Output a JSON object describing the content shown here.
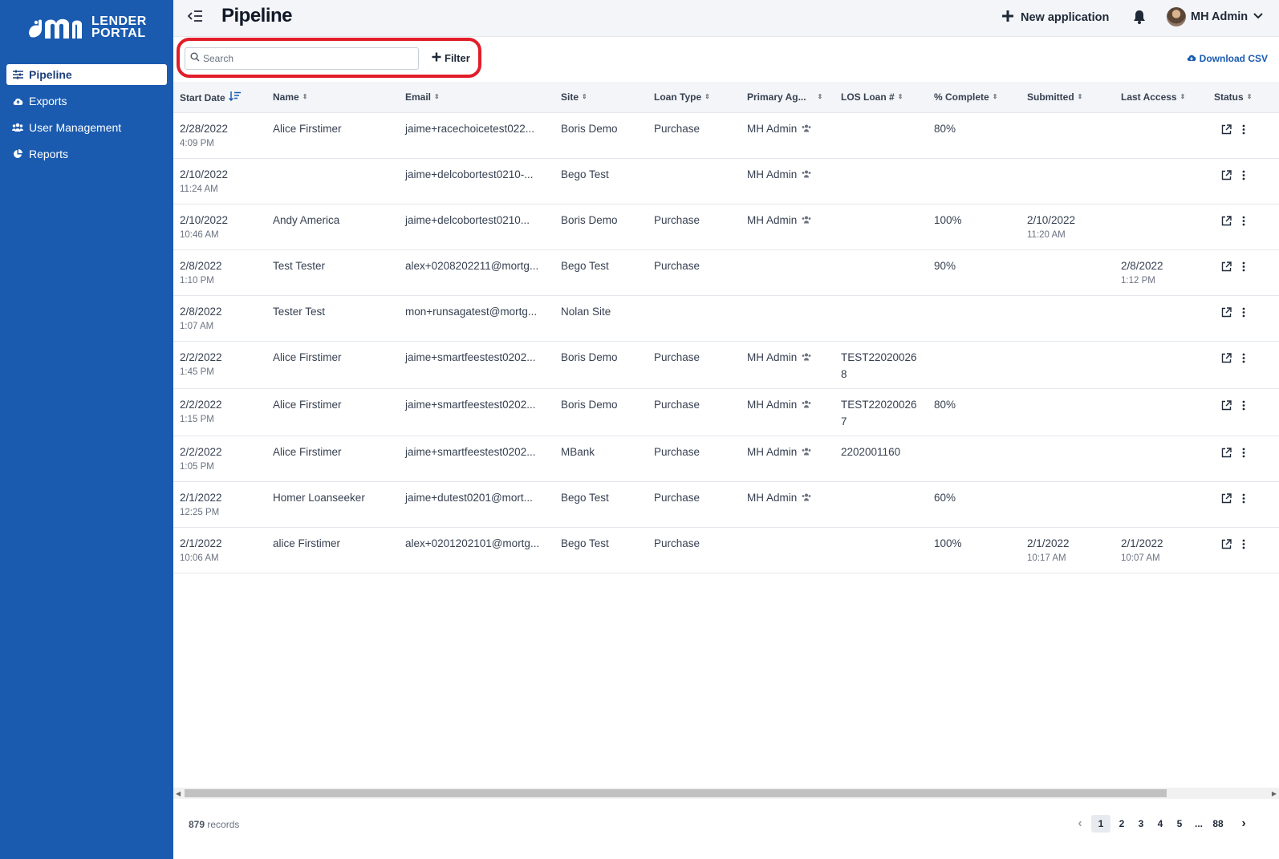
{
  "app": {
    "logo_line1": "LENDER",
    "logo_line2": "PORTAL",
    "brand_color": "#1a5bb0",
    "highlight_color": "#e11d2a"
  },
  "sidebar": {
    "items": [
      {
        "label": "Pipeline",
        "icon": "sliders-icon",
        "active": true
      },
      {
        "label": "Exports",
        "icon": "cloud-upload-icon"
      },
      {
        "label": "User Management",
        "icon": "users-icon"
      },
      {
        "label": "Reports",
        "icon": "pie-chart-icon"
      }
    ]
  },
  "header": {
    "title": "Pipeline",
    "new_application": "New application",
    "user_name": "MH Admin"
  },
  "toolbar": {
    "search_placeholder": "Search",
    "filter_label": "Filter",
    "download_label": "Download CSV"
  },
  "table": {
    "columns": [
      "Start Date",
      "Name",
      "Email",
      "Site",
      "Loan Type",
      "Primary Ag...",
      "LOS Loan #",
      "% Complete",
      "Submitted",
      "Last Access",
      "Status"
    ],
    "rows": [
      {
        "date": "2/28/2022",
        "time": "4:09 PM",
        "name": "Alice Firstimer",
        "email": "jaime+racechoicetest022...",
        "site": "Boris Demo",
        "loan_type": "Purchase",
        "agent": "MH Admin",
        "los": "",
        "complete": "80%",
        "submitted": "",
        "submitted_time": "",
        "last_access": "",
        "last_access_time": ""
      },
      {
        "date": "2/10/2022",
        "time": "11:24 AM",
        "name": "",
        "email": "jaime+delcobortest0210-...",
        "site": "Bego Test",
        "loan_type": "",
        "agent": "MH Admin",
        "los": "",
        "complete": "",
        "submitted": "",
        "submitted_time": "",
        "last_access": "",
        "last_access_time": ""
      },
      {
        "date": "2/10/2022",
        "time": "10:46 AM",
        "name": "Andy America",
        "email": "jaime+delcobortest0210...",
        "site": "Boris Demo",
        "loan_type": "Purchase",
        "agent": "MH Admin",
        "los": "",
        "complete": "100%",
        "submitted": "2/10/2022",
        "submitted_time": "11:20 AM",
        "last_access": "",
        "last_access_time": ""
      },
      {
        "date": "2/8/2022",
        "time": "1:10 PM",
        "name": "Test Tester",
        "email": "alex+0208202211@mortg...",
        "site": "Bego Test",
        "loan_type": "Purchase",
        "agent": "",
        "los": "",
        "complete": "90%",
        "submitted": "",
        "submitted_time": "",
        "last_access": "2/8/2022",
        "last_access_time": "1:12 PM"
      },
      {
        "date": "2/8/2022",
        "time": "1:07 AM",
        "name": "Tester Test",
        "email": "mon+runsagatest@mortg...",
        "site": "Nolan Site",
        "loan_type": "",
        "agent": "",
        "los": "",
        "complete": "",
        "submitted": "",
        "submitted_time": "",
        "last_access": "",
        "last_access_time": ""
      },
      {
        "date": "2/2/2022",
        "time": "1:45 PM",
        "name": "Alice Firstimer",
        "email": "jaime+smartfeestest0202...",
        "site": "Boris Demo",
        "loan_type": "Purchase",
        "agent": "MH Admin",
        "los": "TEST220200268",
        "complete": "",
        "submitted": "",
        "submitted_time": "",
        "last_access": "",
        "last_access_time": ""
      },
      {
        "date": "2/2/2022",
        "time": "1:15 PM",
        "name": "Alice Firstimer",
        "email": "jaime+smartfeestest0202...",
        "site": "Boris Demo",
        "loan_type": "Purchase",
        "agent": "MH Admin",
        "los": "TEST220200267",
        "complete": "80%",
        "submitted": "",
        "submitted_time": "",
        "last_access": "",
        "last_access_time": ""
      },
      {
        "date": "2/2/2022",
        "time": "1:05 PM",
        "name": "Alice Firstimer",
        "email": "jaime+smartfeestest0202...",
        "site": "MBank",
        "loan_type": "Purchase",
        "agent": "MH Admin",
        "los": "2202001160",
        "complete": "",
        "submitted": "",
        "submitted_time": "",
        "last_access": "",
        "last_access_time": ""
      },
      {
        "date": "2/1/2022",
        "time": "12:25 PM",
        "name": "Homer Loanseeker",
        "email": "jaime+dutest0201@mort...",
        "site": "Bego Test",
        "loan_type": "Purchase",
        "agent": "MH Admin",
        "los": "",
        "complete": "60%",
        "submitted": "",
        "submitted_time": "",
        "last_access": "",
        "last_access_time": ""
      },
      {
        "date": "2/1/2022",
        "time": "10:06 AM",
        "name": "alice Firstimer",
        "email": "alex+0201202101@mortg...",
        "site": "Bego Test",
        "loan_type": "Purchase",
        "agent": "",
        "los": "",
        "complete": "100%",
        "submitted": "2/1/2022",
        "submitted_time": "10:17 AM",
        "last_access": "2/1/2022",
        "last_access_time": "10:07 AM"
      }
    ]
  },
  "footer": {
    "record_count": "879",
    "records_label": "records",
    "pages": [
      "1",
      "2",
      "3",
      "4",
      "5"
    ],
    "ellipsis": "...",
    "last_page": "88",
    "current_page": "1"
  }
}
